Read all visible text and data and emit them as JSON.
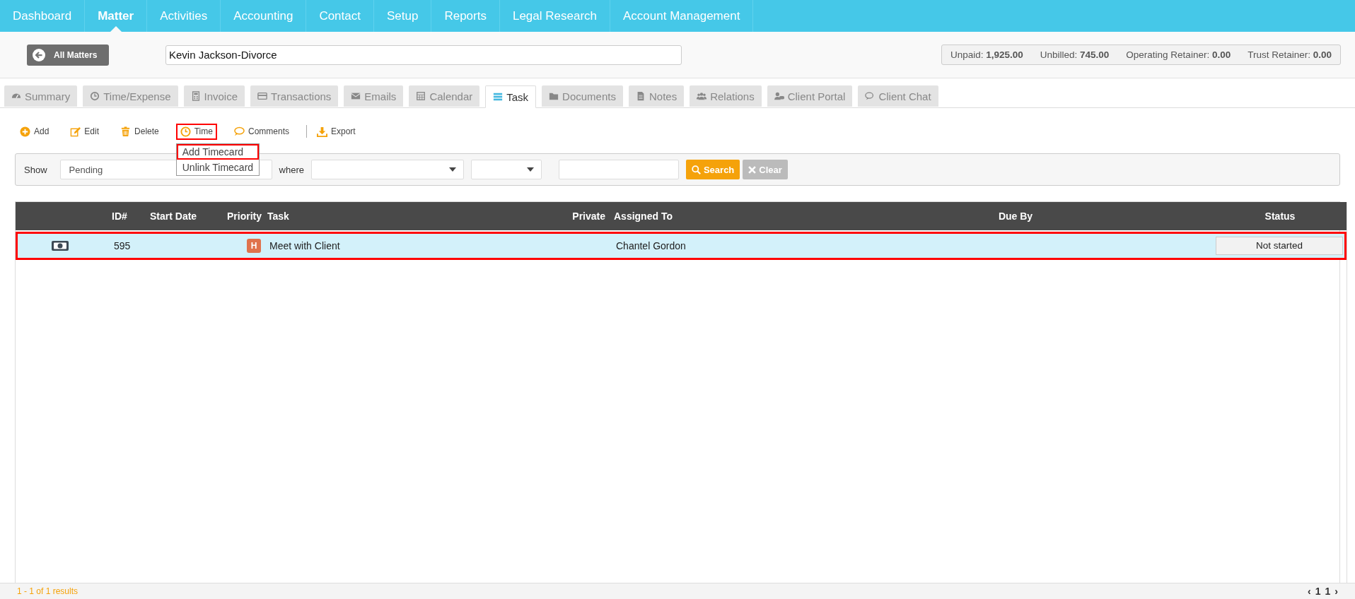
{
  "nav": [
    {
      "label": "Dashboard",
      "selected": false
    },
    {
      "label": "Matter",
      "selected": true
    },
    {
      "label": "Activities",
      "selected": false
    },
    {
      "label": "Accounting",
      "selected": false
    },
    {
      "label": "Contact",
      "selected": false
    },
    {
      "label": "Setup",
      "selected": false
    },
    {
      "label": "Reports",
      "selected": false
    },
    {
      "label": "Legal Research",
      "selected": false
    },
    {
      "label": "Account Management",
      "selected": false
    }
  ],
  "header": {
    "back_button": "All Matters",
    "matter_field": {
      "value": "Kevin Jackson-Divorce"
    },
    "balances": [
      {
        "label": "Unpaid:",
        "value": "1,925.00"
      },
      {
        "label": "Unbilled:",
        "value": "745.00"
      },
      {
        "label": "Operating Retainer:",
        "value": "0.00"
      },
      {
        "label": "Trust Retainer:",
        "value": "0.00"
      }
    ]
  },
  "tabs": [
    {
      "label": "Summary",
      "selected": false
    },
    {
      "label": "Time/Expense",
      "selected": false
    },
    {
      "label": "Invoice",
      "selected": false
    },
    {
      "label": "Transactions",
      "selected": false
    },
    {
      "label": "Emails",
      "selected": false
    },
    {
      "label": "Calendar",
      "selected": false
    },
    {
      "label": "Task",
      "selected": true
    },
    {
      "label": "Documents",
      "selected": false
    },
    {
      "label": "Notes",
      "selected": false
    },
    {
      "label": "Relations",
      "selected": false
    },
    {
      "label": "Client Portal",
      "selected": false
    },
    {
      "label": "Client Chat",
      "selected": false
    }
  ],
  "toolbar": [
    {
      "label": "Add",
      "highlighted": false
    },
    {
      "label": "Edit",
      "highlighted": false
    },
    {
      "label": "Delete",
      "highlighted": false
    },
    {
      "label": "Time",
      "highlighted": true
    },
    {
      "label": "Comments",
      "highlighted": false
    },
    {
      "label": "Export",
      "highlighted": false
    }
  ],
  "time_menu": [
    {
      "label": "Add Timecard",
      "highlighted": true
    },
    {
      "label": "Unlink Timecard",
      "highlighted": false
    }
  ],
  "filter": {
    "show_label": "Show",
    "show_value": "Pending",
    "where_label": "where",
    "search_button": "Search",
    "clear_button": "Clear"
  },
  "table": {
    "columns": [
      "ID#",
      "Start Date",
      "Priority",
      "Task",
      "Private",
      "Assigned To",
      "Due By",
      "Status"
    ],
    "rows": [
      {
        "id": "595",
        "start_date": "",
        "priority": "H",
        "task": "Meet with Client",
        "assigned_to": "Chantel Gordon",
        "status": "Not started",
        "highlighted": true
      }
    ]
  },
  "footer": {
    "results": "1 - 1 of 1 results",
    "pager": [
      "‹",
      "1",
      "1",
      "›"
    ]
  }
}
